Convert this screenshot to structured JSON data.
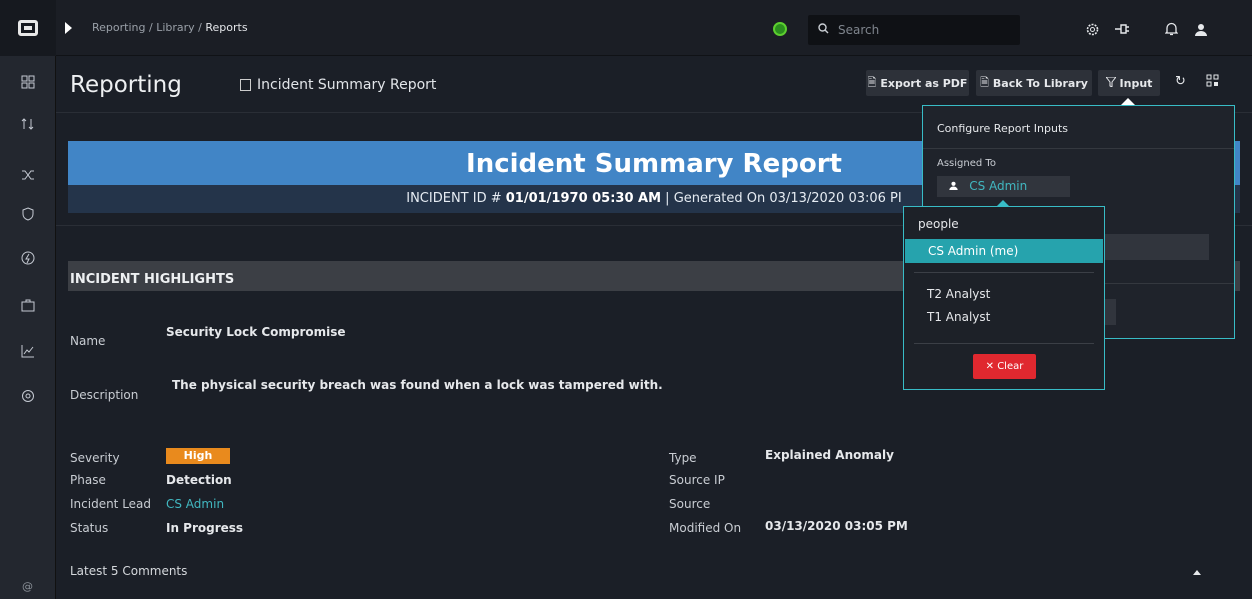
{
  "topbar": {
    "breadcrumb": [
      "Reporting",
      "Library"
    ],
    "breadcrumb_current": "Reports",
    "search_placeholder": "Search"
  },
  "header": {
    "title": "Reporting",
    "report_tab": "Incident Summary Report",
    "export_pdf": "Export as PDF",
    "back_to_library": "Back To Library",
    "input": "Input"
  },
  "report": {
    "banner_title": "Incident Summary Report",
    "banner_sub_prefix": "INCIDENT ID # ",
    "banner_sub_bold": "01/01/1970 05:30 AM",
    "banner_sub_suffix": " | Generated On 03/13/2020 03:06 PI",
    "highlights_title": "INCIDENT HIGHLIGHTS",
    "name_label": "Name",
    "name_value": "Security Lock Compromise",
    "description_label": "Description",
    "description_value": "The physical security breach was found when a lock was tampered with.",
    "severity_label": "Severity",
    "severity_value": "High",
    "phase_label": "Phase",
    "phase_value": "Detection",
    "lead_label": "Incident Lead",
    "lead_value": "CS Admin",
    "status_label": "Status",
    "status_value": "In Progress",
    "type_label": "Type",
    "type_value": "Explained Anomaly",
    "source_ip_label": "Source IP",
    "source_label": "Source",
    "modified_label": "Modified On",
    "modified_value": "03/13/2020 03:05 PM",
    "comments_title": "Latest 5 Comments"
  },
  "input_panel": {
    "title": "Configure Report Inputs",
    "assigned_label": "Assigned To",
    "assigned_value": "CS Admin"
  },
  "dropdown": {
    "header": "people",
    "selected": "CS Admin (me)",
    "items": [
      "T2 Analyst",
      "T1 Analyst"
    ],
    "clear_label": "Clear"
  },
  "colors": {
    "accent": "#38bcc6",
    "banner": "#4185c6",
    "severity_high": "#e98a1d",
    "clear_button": "#e0282f"
  }
}
